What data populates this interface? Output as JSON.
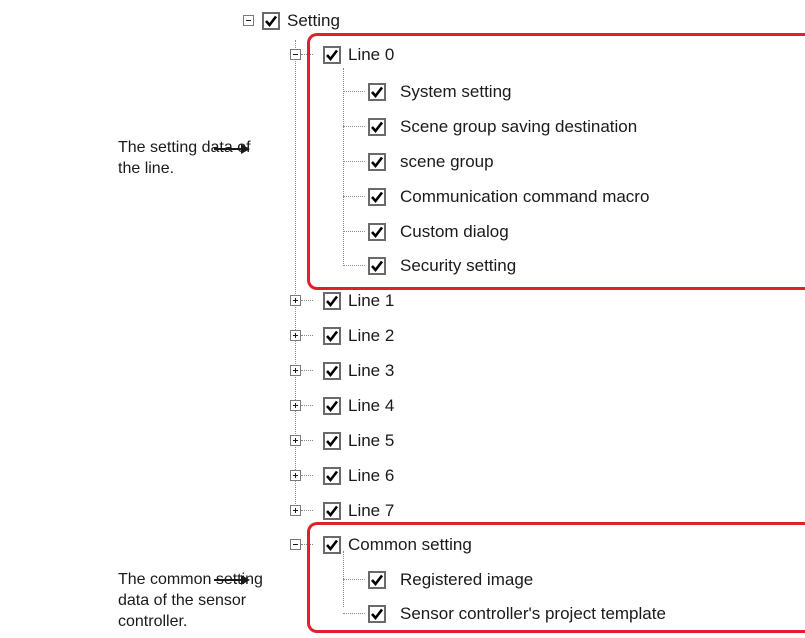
{
  "annotations": {
    "line_data_line1": "The setting data of",
    "line_data_line2": "the line.",
    "common_data_line1": "The common setting",
    "common_data_line2": "data of the sensor",
    "common_data_line3": "controller."
  },
  "tree": {
    "root": {
      "label": "Setting",
      "checked": true,
      "expanded": true
    },
    "line0": {
      "label": "Line 0",
      "checked": true,
      "expanded": true,
      "children": [
        {
          "label": "System setting",
          "checked": true
        },
        {
          "label": "Scene group saving destination",
          "checked": true
        },
        {
          "label": "scene group",
          "checked": true
        },
        {
          "label": "Communication command macro",
          "checked": true
        },
        {
          "label": "Custom dialog",
          "checked": true
        },
        {
          "label": "Security setting",
          "checked": true
        }
      ]
    },
    "collapsed_lines": [
      {
        "label": "Line 1",
        "checked": true,
        "expanded": false
      },
      {
        "label": "Line 2",
        "checked": true,
        "expanded": false
      },
      {
        "label": "Line 3",
        "checked": true,
        "expanded": false
      },
      {
        "label": "Line 4",
        "checked": true,
        "expanded": false
      },
      {
        "label": "Line 5",
        "checked": true,
        "expanded": false
      },
      {
        "label": "Line 6",
        "checked": true,
        "expanded": false
      },
      {
        "label": "Line 7",
        "checked": true,
        "expanded": false
      }
    ],
    "common": {
      "label": "Common setting",
      "checked": true,
      "expanded": true,
      "children": [
        {
          "label": "Registered image",
          "checked": true
        },
        {
          "label": "Sensor controller's project template",
          "checked": true
        }
      ]
    }
  },
  "colors": {
    "highlight": "#e0202a",
    "checkmark": "#000000",
    "tree_lines": "#8a8a8a"
  }
}
